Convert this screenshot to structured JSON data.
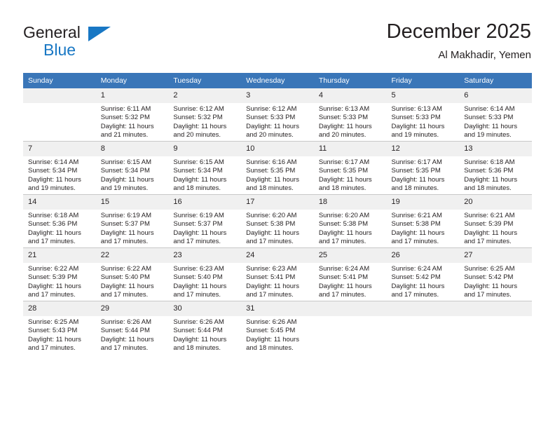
{
  "brand": {
    "name_part1": "General",
    "name_part2": "Blue",
    "logo_icon": "triangle-icon"
  },
  "header": {
    "title": "December 2025",
    "subtitle": "Al Makhadir, Yemen"
  },
  "calendar": {
    "weekday_headers": [
      "Sunday",
      "Monday",
      "Tuesday",
      "Wednesday",
      "Thursday",
      "Friday",
      "Saturday"
    ],
    "colors": {
      "header_background": "#3a76b8",
      "header_text": "#ffffff",
      "daynum_background": "#f0f0f0",
      "cell_background": "#ffffff",
      "grid_line": "#c8c8c8",
      "brand_blue": "#1877c4",
      "text": "#231f20"
    },
    "labels": {
      "sunrise_prefix": "Sunrise:",
      "sunset_prefix": "Sunset:",
      "daylight_prefix": "Daylight:"
    },
    "weeks": [
      [
        {
          "day": "",
          "blank": true,
          "sunrise": "",
          "sunset": "",
          "daylight_line1": "",
          "daylight_line2": ""
        },
        {
          "day": "1",
          "sunrise": "Sunrise: 6:11 AM",
          "sunset": "Sunset: 5:32 PM",
          "daylight_line1": "Daylight: 11 hours",
          "daylight_line2": "and 21 minutes."
        },
        {
          "day": "2",
          "sunrise": "Sunrise: 6:12 AM",
          "sunset": "Sunset: 5:32 PM",
          "daylight_line1": "Daylight: 11 hours",
          "daylight_line2": "and 20 minutes."
        },
        {
          "day": "3",
          "sunrise": "Sunrise: 6:12 AM",
          "sunset": "Sunset: 5:33 PM",
          "daylight_line1": "Daylight: 11 hours",
          "daylight_line2": "and 20 minutes."
        },
        {
          "day": "4",
          "sunrise": "Sunrise: 6:13 AM",
          "sunset": "Sunset: 5:33 PM",
          "daylight_line1": "Daylight: 11 hours",
          "daylight_line2": "and 20 minutes."
        },
        {
          "day": "5",
          "sunrise": "Sunrise: 6:13 AM",
          "sunset": "Sunset: 5:33 PM",
          "daylight_line1": "Daylight: 11 hours",
          "daylight_line2": "and 19 minutes."
        },
        {
          "day": "6",
          "sunrise": "Sunrise: 6:14 AM",
          "sunset": "Sunset: 5:33 PM",
          "daylight_line1": "Daylight: 11 hours",
          "daylight_line2": "and 19 minutes."
        }
      ],
      [
        {
          "day": "7",
          "sunrise": "Sunrise: 6:14 AM",
          "sunset": "Sunset: 5:34 PM",
          "daylight_line1": "Daylight: 11 hours",
          "daylight_line2": "and 19 minutes."
        },
        {
          "day": "8",
          "sunrise": "Sunrise: 6:15 AM",
          "sunset": "Sunset: 5:34 PM",
          "daylight_line1": "Daylight: 11 hours",
          "daylight_line2": "and 19 minutes."
        },
        {
          "day": "9",
          "sunrise": "Sunrise: 6:15 AM",
          "sunset": "Sunset: 5:34 PM",
          "daylight_line1": "Daylight: 11 hours",
          "daylight_line2": "and 18 minutes."
        },
        {
          "day": "10",
          "sunrise": "Sunrise: 6:16 AM",
          "sunset": "Sunset: 5:35 PM",
          "daylight_line1": "Daylight: 11 hours",
          "daylight_line2": "and 18 minutes."
        },
        {
          "day": "11",
          "sunrise": "Sunrise: 6:17 AM",
          "sunset": "Sunset: 5:35 PM",
          "daylight_line1": "Daylight: 11 hours",
          "daylight_line2": "and 18 minutes."
        },
        {
          "day": "12",
          "sunrise": "Sunrise: 6:17 AM",
          "sunset": "Sunset: 5:35 PM",
          "daylight_line1": "Daylight: 11 hours",
          "daylight_line2": "and 18 minutes."
        },
        {
          "day": "13",
          "sunrise": "Sunrise: 6:18 AM",
          "sunset": "Sunset: 5:36 PM",
          "daylight_line1": "Daylight: 11 hours",
          "daylight_line2": "and 18 minutes."
        }
      ],
      [
        {
          "day": "14",
          "sunrise": "Sunrise: 6:18 AM",
          "sunset": "Sunset: 5:36 PM",
          "daylight_line1": "Daylight: 11 hours",
          "daylight_line2": "and 17 minutes."
        },
        {
          "day": "15",
          "sunrise": "Sunrise: 6:19 AM",
          "sunset": "Sunset: 5:37 PM",
          "daylight_line1": "Daylight: 11 hours",
          "daylight_line2": "and 17 minutes."
        },
        {
          "day": "16",
          "sunrise": "Sunrise: 6:19 AM",
          "sunset": "Sunset: 5:37 PM",
          "daylight_line1": "Daylight: 11 hours",
          "daylight_line2": "and 17 minutes."
        },
        {
          "day": "17",
          "sunrise": "Sunrise: 6:20 AM",
          "sunset": "Sunset: 5:38 PM",
          "daylight_line1": "Daylight: 11 hours",
          "daylight_line2": "and 17 minutes."
        },
        {
          "day": "18",
          "sunrise": "Sunrise: 6:20 AM",
          "sunset": "Sunset: 5:38 PM",
          "daylight_line1": "Daylight: 11 hours",
          "daylight_line2": "and 17 minutes."
        },
        {
          "day": "19",
          "sunrise": "Sunrise: 6:21 AM",
          "sunset": "Sunset: 5:38 PM",
          "daylight_line1": "Daylight: 11 hours",
          "daylight_line2": "and 17 minutes."
        },
        {
          "day": "20",
          "sunrise": "Sunrise: 6:21 AM",
          "sunset": "Sunset: 5:39 PM",
          "daylight_line1": "Daylight: 11 hours",
          "daylight_line2": "and 17 minutes."
        }
      ],
      [
        {
          "day": "21",
          "sunrise": "Sunrise: 6:22 AM",
          "sunset": "Sunset: 5:39 PM",
          "daylight_line1": "Daylight: 11 hours",
          "daylight_line2": "and 17 minutes."
        },
        {
          "day": "22",
          "sunrise": "Sunrise: 6:22 AM",
          "sunset": "Sunset: 5:40 PM",
          "daylight_line1": "Daylight: 11 hours",
          "daylight_line2": "and 17 minutes."
        },
        {
          "day": "23",
          "sunrise": "Sunrise: 6:23 AM",
          "sunset": "Sunset: 5:40 PM",
          "daylight_line1": "Daylight: 11 hours",
          "daylight_line2": "and 17 minutes."
        },
        {
          "day": "24",
          "sunrise": "Sunrise: 6:23 AM",
          "sunset": "Sunset: 5:41 PM",
          "daylight_line1": "Daylight: 11 hours",
          "daylight_line2": "and 17 minutes."
        },
        {
          "day": "25",
          "sunrise": "Sunrise: 6:24 AM",
          "sunset": "Sunset: 5:41 PM",
          "daylight_line1": "Daylight: 11 hours",
          "daylight_line2": "and 17 minutes."
        },
        {
          "day": "26",
          "sunrise": "Sunrise: 6:24 AM",
          "sunset": "Sunset: 5:42 PM",
          "daylight_line1": "Daylight: 11 hours",
          "daylight_line2": "and 17 minutes."
        },
        {
          "day": "27",
          "sunrise": "Sunrise: 6:25 AM",
          "sunset": "Sunset: 5:42 PM",
          "daylight_line1": "Daylight: 11 hours",
          "daylight_line2": "and 17 minutes."
        }
      ],
      [
        {
          "day": "28",
          "sunrise": "Sunrise: 6:25 AM",
          "sunset": "Sunset: 5:43 PM",
          "daylight_line1": "Daylight: 11 hours",
          "daylight_line2": "and 17 minutes."
        },
        {
          "day": "29",
          "sunrise": "Sunrise: 6:26 AM",
          "sunset": "Sunset: 5:44 PM",
          "daylight_line1": "Daylight: 11 hours",
          "daylight_line2": "and 17 minutes."
        },
        {
          "day": "30",
          "sunrise": "Sunrise: 6:26 AM",
          "sunset": "Sunset: 5:44 PM",
          "daylight_line1": "Daylight: 11 hours",
          "daylight_line2": "and 18 minutes."
        },
        {
          "day": "31",
          "sunrise": "Sunrise: 6:26 AM",
          "sunset": "Sunset: 5:45 PM",
          "daylight_line1": "Daylight: 11 hours",
          "daylight_line2": "and 18 minutes."
        },
        {
          "day": "",
          "blank": true,
          "sunrise": "",
          "sunset": "",
          "daylight_line1": "",
          "daylight_line2": ""
        },
        {
          "day": "",
          "blank": true,
          "sunrise": "",
          "sunset": "",
          "daylight_line1": "",
          "daylight_line2": ""
        },
        {
          "day": "",
          "blank": true,
          "sunrise": "",
          "sunset": "",
          "daylight_line1": "",
          "daylight_line2": ""
        }
      ]
    ]
  }
}
